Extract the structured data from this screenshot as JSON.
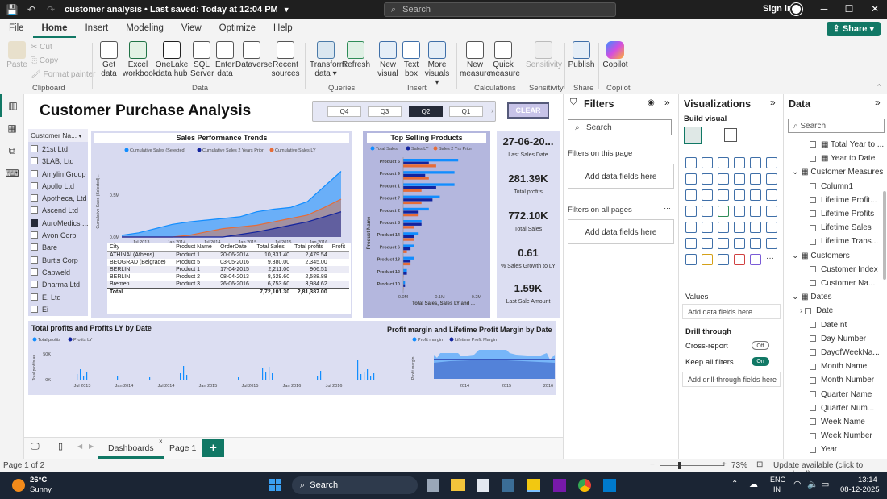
{
  "titlebar": {
    "doc_title": "customer analysis • Last saved: Today at 12:04 PM",
    "search_placeholder": "Search",
    "signin": "Sign in"
  },
  "menu": [
    "File",
    "Home",
    "Insert",
    "Modeling",
    "View",
    "Optimize",
    "Help"
  ],
  "share_label": "Share",
  "ribbon": {
    "clipboard": {
      "paste": "Paste",
      "cut": "Cut",
      "copy": "Copy",
      "format_painter": "Format painter",
      "group": "Clipboard"
    },
    "data_items": [
      "Get data",
      "Excel workbook",
      "OneLake data hub",
      "SQL Server",
      "Enter data",
      "Dataverse",
      "Recent sources"
    ],
    "data_group": "Data",
    "queries_items": [
      "Transform data",
      "Refresh"
    ],
    "queries_group": "Queries",
    "insert_items": [
      "New visual",
      "Text box",
      "More visuals"
    ],
    "insert_group": "Insert",
    "calc_items": [
      "New measure",
      "Quick measure"
    ],
    "calc_group": "Calculations",
    "sens_item": "Sensitivity",
    "sens_group": "Sensitivity",
    "share_item": "Publish",
    "share_group": "Share",
    "copilot_item": "Copilot",
    "copilot_group": "Copilot"
  },
  "report": {
    "title": "Customer Purchase Analysis",
    "quarters": [
      "Q4",
      "Q3",
      "Q2",
      "Q1"
    ],
    "selected_quarter": "Q2",
    "clear_label": "CLEAR",
    "slicer": {
      "header": "Customer Na...",
      "items": [
        "21st Ltd",
        "3LAB, Ltd",
        "Amylin Group",
        "Apollo Ltd",
        "Apotheca, Ltd",
        "Ascend Ltd",
        "AuroMedics ...",
        "Avon Corp",
        "Bare",
        "Burt's Corp",
        "Capweld",
        "Dharma Ltd",
        "E. Ltd",
        "Ei"
      ],
      "checked_index": 6
    },
    "cards": [
      {
        "value": "27-06-20...",
        "label": "Last Sales Date"
      },
      {
        "value": "281.39K",
        "label": "Total profits"
      },
      {
        "value": "772.10K",
        "label": "Total Sales"
      },
      {
        "value": "0.61",
        "label": "% Sales Growth to LY"
      },
      {
        "value": "1.59K",
        "label": "Last Sale Amount"
      }
    ],
    "table": {
      "headers": [
        "City",
        "Product Name",
        "OrderDate",
        "Total Sales",
        "Total profits",
        "Profit"
      ],
      "rows": [
        [
          "ATHINAI (Athens)",
          "Product 1",
          "20-06-2014",
          "10,331.40",
          "2,479.54",
          ""
        ],
        [
          "BEOGRAD (Belgrade)",
          "Product 5",
          "03-05-2016",
          "9,380.00",
          "2,345.00",
          ""
        ],
        [
          "BERLIN",
          "Product 1",
          "17-04-2015",
          "2,211.00",
          "906.51",
          ""
        ],
        [
          "BERLIN",
          "Product 2",
          "08-04-2013",
          "8,629.60",
          "2,588.88",
          ""
        ],
        [
          "Bremen",
          "Product 3",
          "26-06-2016",
          "6,753.60",
          "3,984.62",
          ""
        ]
      ],
      "total": [
        "Total",
        "",
        "",
        "7,72,101.30",
        "2,81,387.00",
        ""
      ]
    }
  },
  "chart_data": [
    {
      "type": "area",
      "title": "Sales Performance Trends",
      "legend": [
        "Cumulative Sales (Selected)",
        "Cumulative Sales 2 Years Prior",
        "Cumulative Sales LY"
      ],
      "ylabel": "Cumulative Sales (Selected)...",
      "xlabel": "Date",
      "x_ticks": [
        "Jul 2013",
        "Jan 2014",
        "Jul 2014",
        "Jan 2015",
        "Jul 2015",
        "Jan 2016"
      ],
      "y_ticks": [
        "0.0M",
        "0.5M"
      ],
      "ylim": [
        0,
        0.9
      ],
      "series": [
        {
          "name": "Cumulative Sales (Selected)",
          "values": [
            0.02,
            0.05,
            0.1,
            0.15,
            0.18,
            0.2,
            0.22,
            0.24,
            0.3,
            0.33,
            0.35,
            0.42,
            0.6,
            0.78
          ],
          "color": "#118dff"
        },
        {
          "name": "Cumulative Sales LY",
          "values": [
            0,
            0,
            0,
            0,
            0.02,
            0.06,
            0.1,
            0.12,
            0.14,
            0.18,
            0.22,
            0.26,
            0.35,
            0.45
          ],
          "color": "#e66c37"
        },
        {
          "name": "Cumulative Sales 2 Years Prior",
          "values": [
            0,
            0,
            0,
            0,
            0,
            0,
            0,
            0.03,
            0.06,
            0.1,
            0.14,
            0.18,
            0.24,
            0.3
          ],
          "color": "#12239e"
        }
      ]
    },
    {
      "type": "bar",
      "title": "Top Selling Products",
      "legend": [
        "Total Sales",
        "Sales LY",
        "Sales 2 Yrs Prior"
      ],
      "categories": [
        "Product 5",
        "Product 9",
        "Product 1",
        "Product 7",
        "Product 2",
        "Product 8",
        "Product 14",
        "Product 6",
        "Product 13",
        "Product 12",
        "Product 10"
      ],
      "ylabel": "Product Name",
      "xlabel": "Total Sales, Sales LY and ...",
      "x_ticks": [
        "0.0M",
        "0.1M",
        "0.2M"
      ],
      "xlim": [
        0,
        0.22
      ],
      "series": [
        {
          "name": "Total Sales",
          "values": [
            0.15,
            0.14,
            0.14,
            0.1,
            0.07,
            0.05,
            0.04,
            0.03,
            0.03,
            0.01,
            0.005
          ],
          "color": "#118dff"
        },
        {
          "name": "Sales LY",
          "values": [
            0.07,
            0.06,
            0.09,
            0.08,
            0.04,
            0.05,
            0.03,
            0.02,
            0.02,
            0.01,
            0.005
          ],
          "color": "#12239e"
        },
        {
          "name": "Sales 2 Yrs Prior",
          "values": [
            0.09,
            0.07,
            0.05,
            0.05,
            0.04,
            0.03,
            0.03,
            0.01,
            0.02,
            0.0,
            0.0
          ],
          "color": "#e66c37"
        }
      ]
    },
    {
      "type": "bar",
      "title": "Total profits and Profits LY by Date",
      "legend": [
        "Total profits",
        "Profits LY"
      ],
      "ylabel": "Total profits an...",
      "y_ticks": [
        "0K",
        "50K"
      ],
      "x_ticks": [
        "Jul 2013",
        "Jan 2014",
        "Jul 2014",
        "Jan 2015",
        "Jul 2015",
        "Jan 2016",
        "Jul 2016"
      ],
      "ylim": [
        0,
        60
      ]
    },
    {
      "type": "area",
      "title": "Profit margin and Lifetime Profit Margin by Date",
      "legend": [
        "Profit margin",
        "Lifetime Profit Margin"
      ],
      "ylabel": "Profit margin ...",
      "x_ticks": [
        "2014",
        "2015",
        "2016"
      ]
    }
  ],
  "filters": {
    "title": "Filters",
    "search": "Search",
    "on_page": "Filters on this page",
    "all_pages": "Filters on all pages",
    "add": "Add data fields here"
  },
  "viz": {
    "title": "Visualizations",
    "build": "Build visual",
    "values": "Values",
    "add": "Add data fields here",
    "drill": "Drill through",
    "cross": "Cross-report",
    "cross_state": "Off",
    "keep": "Keep all filters",
    "keep_state": "On",
    "drill_add": "Add drill-through fields here"
  },
  "data": {
    "title": "Data",
    "search": "Search",
    "rows": [
      {
        "t": "Total Year to ...",
        "lvl": 2,
        "kind": "field"
      },
      {
        "t": "Year to Date",
        "lvl": 2,
        "kind": "field"
      },
      {
        "t": "Customer Measures",
        "lvl": 0,
        "kind": "table"
      },
      {
        "t": "Column1",
        "lvl": 1,
        "kind": "field"
      },
      {
        "t": "Lifetime Profit...",
        "lvl": 1,
        "kind": "field"
      },
      {
        "t": "Lifetime Profits",
        "lvl": 1,
        "kind": "field"
      },
      {
        "t": "Lifetime Sales",
        "lvl": 1,
        "kind": "field"
      },
      {
        "t": "Lifetime Trans...",
        "lvl": 1,
        "kind": "field"
      },
      {
        "t": "Customers",
        "lvl": 0,
        "kind": "table"
      },
      {
        "t": "Customer Index",
        "lvl": 1,
        "kind": "field"
      },
      {
        "t": "Customer Na...",
        "lvl": 1,
        "kind": "field"
      },
      {
        "t": "Dates",
        "lvl": 0,
        "kind": "table"
      },
      {
        "t": "Date",
        "lvl": 1,
        "kind": "group"
      },
      {
        "t": "DateInt",
        "lvl": 1,
        "kind": "field"
      },
      {
        "t": "Day Number",
        "lvl": 1,
        "kind": "field"
      },
      {
        "t": "DayofWeekNa...",
        "lvl": 1,
        "kind": "field"
      },
      {
        "t": "Month Name",
        "lvl": 1,
        "kind": "field"
      },
      {
        "t": "Month Number",
        "lvl": 1,
        "kind": "field"
      },
      {
        "t": "Quarter Name",
        "lvl": 1,
        "kind": "field"
      },
      {
        "t": "Quarter Num...",
        "lvl": 1,
        "kind": "field"
      },
      {
        "t": "Week Name",
        "lvl": 1,
        "kind": "field"
      },
      {
        "t": "Week Number",
        "lvl": 1,
        "kind": "field"
      },
      {
        "t": "Year",
        "lvl": 1,
        "kind": "field"
      }
    ]
  },
  "pages": {
    "active": "Dashboards",
    "other": "Page 1"
  },
  "status": {
    "page": "Page 1 of 2",
    "zoom": "73%",
    "update": "Update available (click to download)"
  },
  "taskbar": {
    "temp": "26°C",
    "weather": "Sunny",
    "search": "Search",
    "lang1": "ENG",
    "lang2": "IN",
    "time": "13:14",
    "date": "08-12-2025"
  }
}
